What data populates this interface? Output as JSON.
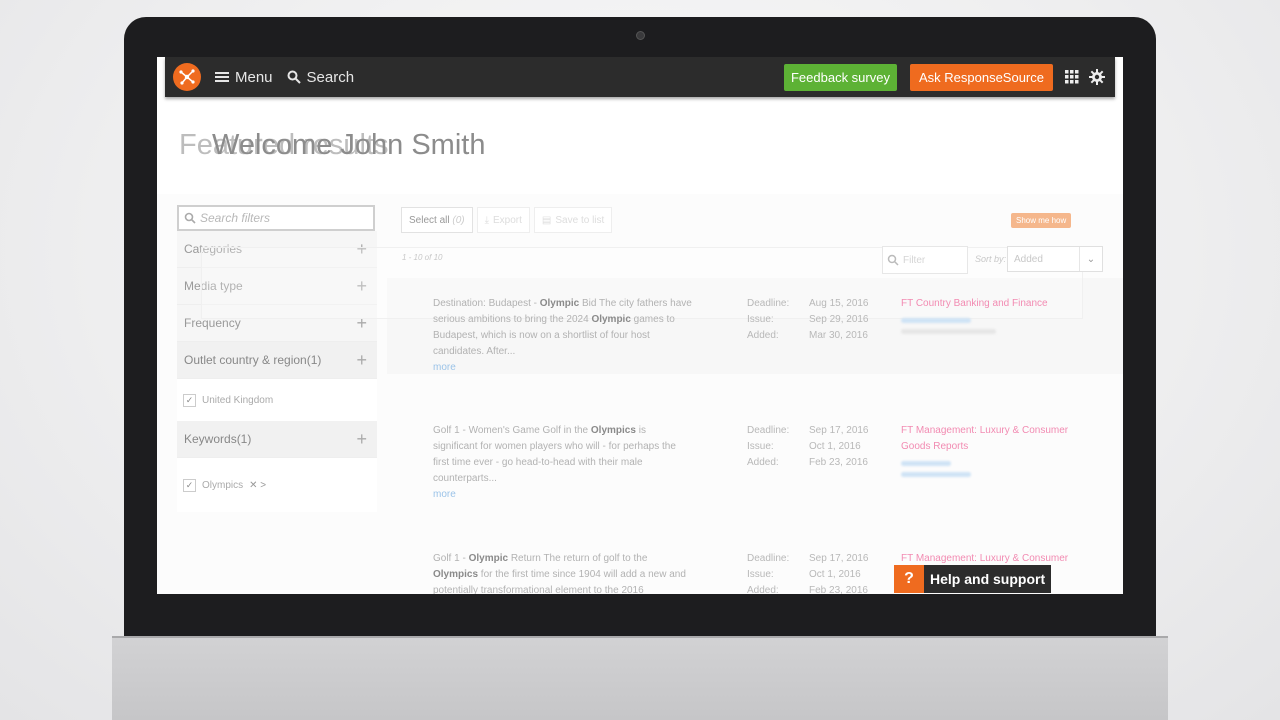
{
  "topbar": {
    "menu_label": "Menu",
    "search_label": "Search",
    "feedback_label": "Feedback survey",
    "ask_label": "Ask ResponseSource"
  },
  "page": {
    "heading_back": "Featured results",
    "heading_front": "Welcome John Smith"
  },
  "filters": {
    "search_placeholder": "Search filters",
    "items": [
      {
        "label": "Categories"
      },
      {
        "label": "Media type"
      },
      {
        "label": "Frequency"
      },
      {
        "label": "Outlet country & region(1)"
      }
    ],
    "country_checked": "United Kingdom",
    "keywords_label": "Keywords(1)",
    "keyword_checked": "Olympics",
    "keyword_suffix": "✕ >"
  },
  "toolbar": {
    "select_all": "Select all",
    "select_count": "(0)",
    "export": "Export",
    "save_to_list": "Save to list",
    "show_me_how": "Show me how",
    "range": "1 - 10 of 10",
    "filter_placeholder": "Filter",
    "sort_by": "Sort by:",
    "sort_value": "Added"
  },
  "meta_labels": {
    "deadline": "Deadline:",
    "issue": "Issue:",
    "added": "Added:"
  },
  "results": [
    {
      "desc_parts": [
        "Destination: Budapest - ",
        "Olympic",
        " Bid The city fathers have serious ambitions to bring the 2024 ",
        "Olympic",
        " games to Budapest, which is now on a shortlist of four host candidates. After..."
      ],
      "more": "more",
      "deadline": "Aug 15, 2016",
      "issue": "Sep 29, 2016",
      "added": "Mar 30, 2016",
      "publication": "FT Country Banking and Finance"
    },
    {
      "desc_parts": [
        "Golf 1 - Women's Game Golf in the ",
        "Olympics",
        " is significant for women players who will - for perhaps the first time ever - go head-to-head with their male counterparts..."
      ],
      "more": "more",
      "deadline": "Sep 17, 2016",
      "issue": "Oct 1, 2016",
      "added": "Feb 23, 2016",
      "publication": "FT Management: Luxury & Consumer Goods Reports"
    },
    {
      "desc_parts": [
        "Golf 1 - ",
        "Olympic",
        " Return The return of golf to the ",
        "Olympics",
        " for the first time since 1904 will add a new and potentially transformational element to the 2016"
      ],
      "deadline": "Sep 17, 2016",
      "issue": "Oct 1, 2016",
      "added": "Feb 23, 2016",
      "publication": "FT Management: Luxury & Consumer"
    }
  ],
  "help": {
    "icon": "?",
    "label": "Help and support"
  },
  "colors": {
    "orange": "#ef6b1f",
    "green": "#5db235",
    "topbar": "#2c2c2c",
    "link_pink": "#f28bb2"
  }
}
